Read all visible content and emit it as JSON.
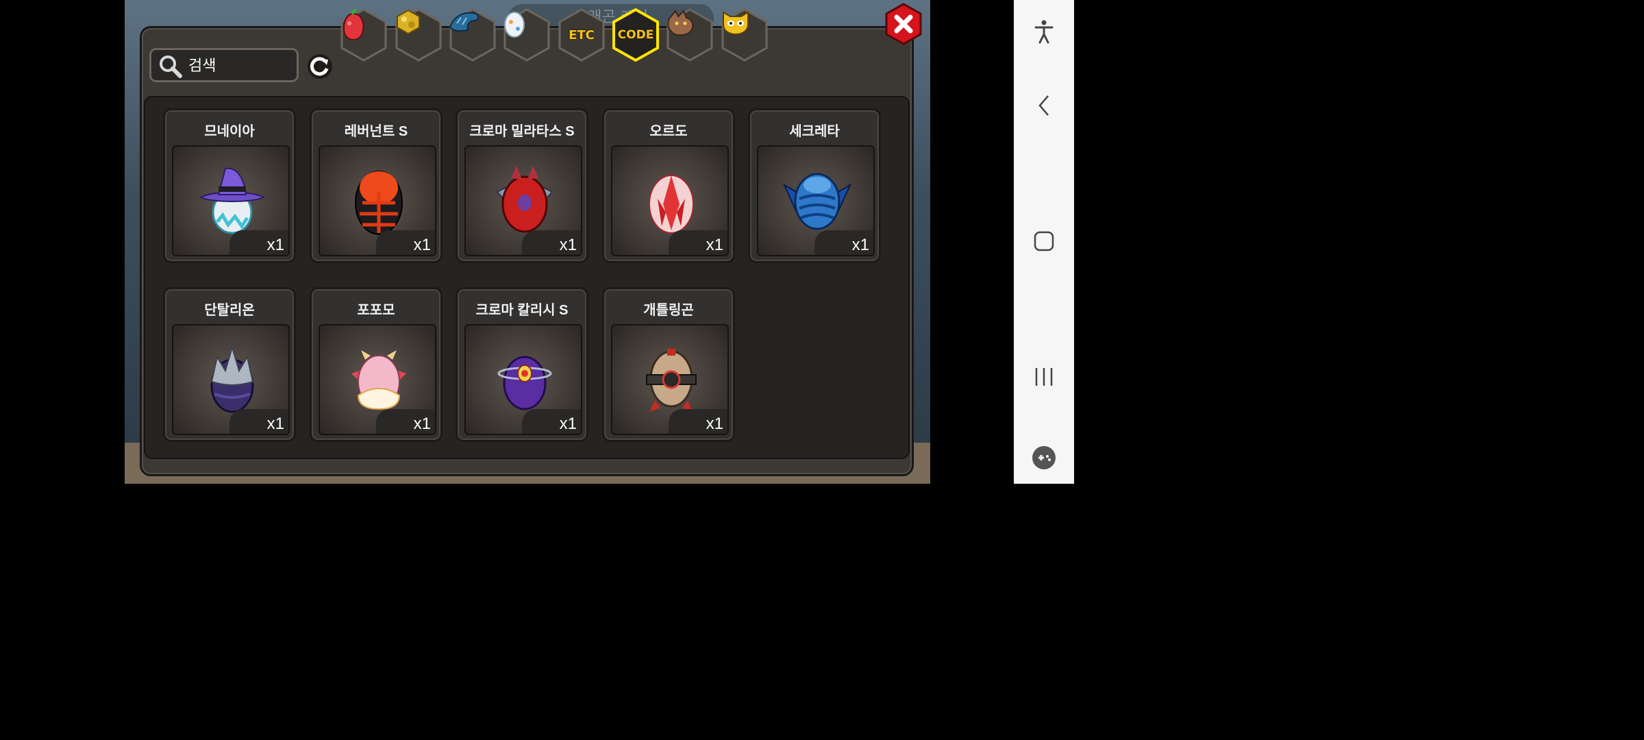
{
  "background": {
    "title_ghost": "드래곤 케이"
  },
  "search": {
    "placeholder": "검색"
  },
  "tabs": [
    {
      "id": "fruit",
      "icon": "fruit-icon",
      "label": ""
    },
    {
      "id": "gold",
      "icon": "gold-ore-icon",
      "label": ""
    },
    {
      "id": "dragon",
      "icon": "blue-dragon-icon",
      "label": ""
    },
    {
      "id": "egg",
      "icon": "egg-icon",
      "label": ""
    },
    {
      "id": "etc",
      "icon": "",
      "label": "ETC"
    },
    {
      "id": "code",
      "icon": "",
      "label": "CODE",
      "selected": true
    },
    {
      "id": "wyvern",
      "icon": "brown-dragon-head-icon",
      "label": ""
    },
    {
      "id": "mask",
      "icon": "yellow-mask-icon",
      "label": ""
    }
  ],
  "items": [
    {
      "name": "므네이아",
      "qty": "x1",
      "icon": "witch-hat-egg-icon"
    },
    {
      "name": "레버넌트 S",
      "qty": "x1",
      "icon": "lava-egg-icon"
    },
    {
      "name": "크로마 밀라타스 S",
      "qty": "x1",
      "icon": "red-winged-egg-icon"
    },
    {
      "name": "오르도",
      "qty": "x1",
      "icon": "crystal-egg-icon"
    },
    {
      "name": "세크레타",
      "qty": "x1",
      "icon": "blue-scaled-egg-icon"
    },
    {
      "name": "단탈리온",
      "qty": "x1",
      "icon": "silver-crown-egg-icon"
    },
    {
      "name": "포포모",
      "qty": "x1",
      "icon": "pink-horned-egg-icon"
    },
    {
      "name": "크로마 칼리시 S",
      "qty": "x1",
      "icon": "purple-gem-egg-icon"
    },
    {
      "name": "개틀링곤",
      "qty": "x1",
      "icon": "mech-egg-icon"
    }
  ],
  "colors": {
    "selected_tab": "#ffe600",
    "tab_text": "#f3c21c",
    "close": "#d6141c"
  }
}
